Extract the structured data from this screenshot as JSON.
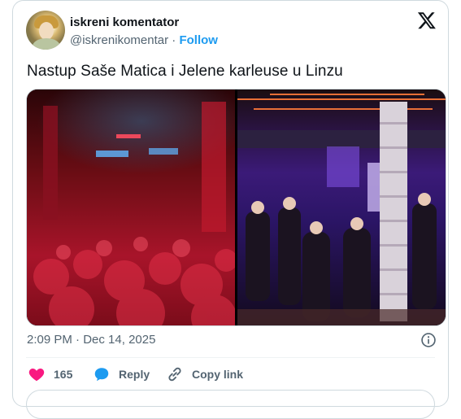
{
  "author": {
    "display_name": "iskreni komentator",
    "handle": "@iskrenikomentar",
    "separator": "·",
    "follow_label": "Follow"
  },
  "tweet": {
    "text": "Nastup Saše Matica i Jelene karleuse u Linzu",
    "time": "2:09 PM",
    "date": "Dec 14, 2025"
  },
  "actions": {
    "likes_count": "165",
    "reply_label": "Reply",
    "copy_link_label": "Copy link"
  },
  "colors": {
    "accent": "#1d9bf0",
    "like": "#f91880",
    "muted": "#536471"
  },
  "icons": [
    "x-logo-icon",
    "info-icon",
    "heart-icon",
    "reply-icon",
    "link-icon"
  ]
}
